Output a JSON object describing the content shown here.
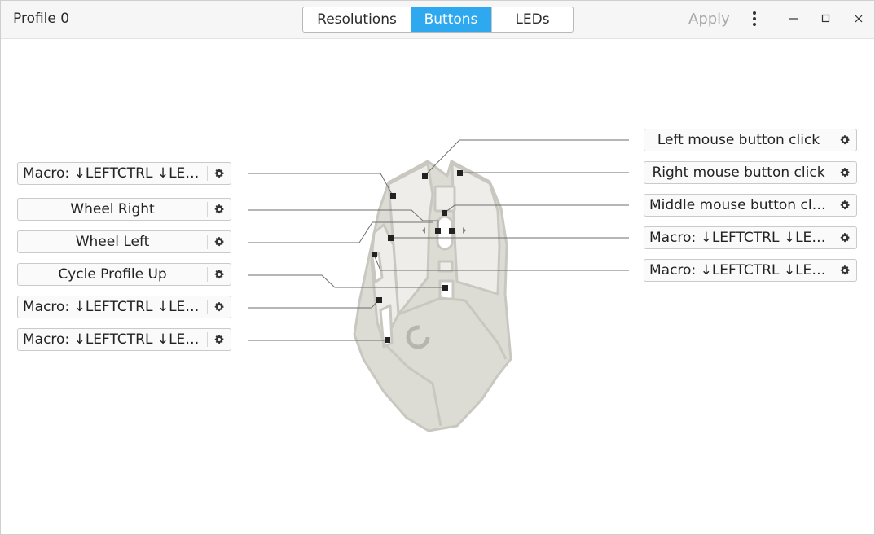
{
  "header": {
    "profile_title": "Profile 0",
    "tabs": [
      {
        "label": "Resolutions",
        "active": false
      },
      {
        "label": "Buttons",
        "active": true
      },
      {
        "label": "LEDs",
        "active": false
      }
    ],
    "apply_label": "Apply"
  },
  "colors": {
    "accent": "#2ea8ee",
    "mouse_body": "#dcdbd4",
    "mouse_outline": "#c8c7c0"
  },
  "left_buttons": [
    {
      "label": "Macro: ↓LEFTCTRL ↓LEFTALT",
      "icon": "gear-icon"
    },
    {
      "label": "Wheel Right",
      "icon": "gear-icon"
    },
    {
      "label": "Wheel Left",
      "icon": "gear-icon"
    },
    {
      "label": "Cycle Profile Up",
      "icon": "gear-icon"
    },
    {
      "label": "Macro: ↓LEFTCTRL ↓LEFTALT",
      "icon": "gear-icon"
    },
    {
      "label": "Macro: ↓LEFTCTRL ↓LEFTALT",
      "icon": "gear-icon"
    }
  ],
  "right_buttons": [
    {
      "label": "Left mouse button click",
      "icon": "gear-icon"
    },
    {
      "label": "Right mouse button click",
      "icon": "gear-icon"
    },
    {
      "label": "Middle mouse button click",
      "icon": "gear-icon"
    },
    {
      "label": "Macro: ↓LEFTCTRL ↓LEFTALT",
      "icon": "gear-icon"
    },
    {
      "label": "Macro: ↓LEFTCTRL ↓LEFTALT",
      "icon": "gear-icon"
    }
  ]
}
